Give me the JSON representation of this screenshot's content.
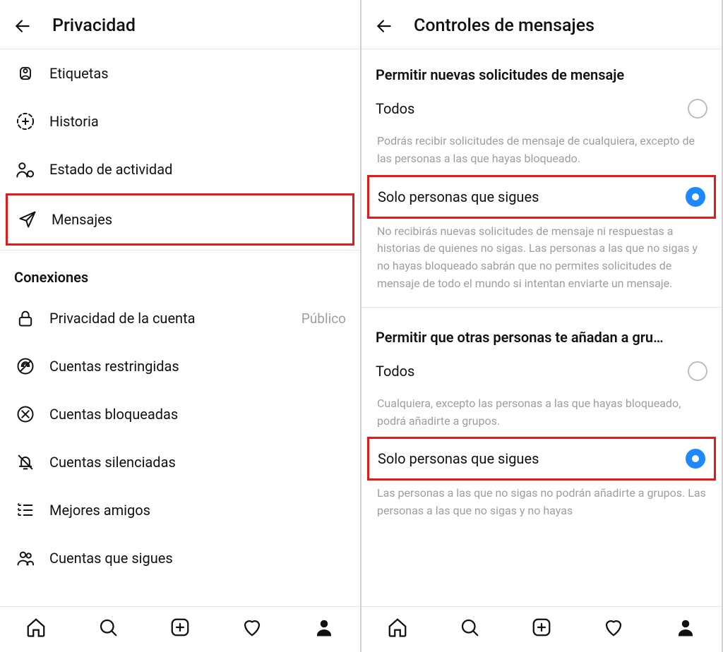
{
  "left": {
    "title": "Privacidad",
    "items_top": [
      {
        "icon": "tags-icon",
        "label": "Etiquetas"
      },
      {
        "icon": "story-icon",
        "label": "Historia"
      },
      {
        "icon": "activity-icon",
        "label": "Estado de actividad"
      }
    ],
    "highlighted_item": {
      "icon": "messages-icon",
      "label": "Mensajes"
    },
    "section_title": "Conexiones",
    "items_bottom": [
      {
        "icon": "lock-icon",
        "label": "Privacidad de la cuenta",
        "meta": "Público"
      },
      {
        "icon": "restricted-icon",
        "label": "Cuentas restringidas"
      },
      {
        "icon": "blocked-icon",
        "label": "Cuentas bloqueadas"
      },
      {
        "icon": "muted-icon",
        "label": "Cuentas silenciadas"
      },
      {
        "icon": "close-friends-icon",
        "label": "Mejores amigos"
      },
      {
        "icon": "following-icon",
        "label": "Cuentas que sigues"
      }
    ]
  },
  "right": {
    "title": "Controles de mensajes",
    "section1": {
      "head": "Permitir nuevas solicitudes de mensaje",
      "opt1_label": "Todos",
      "opt1_desc": "Podrás recibir solicitudes de mensaje de cualquiera, excepto de las personas a las que hayas bloqueado.",
      "opt2_label": "Solo personas que sigues",
      "opt2_desc": "No recibirás nuevas solicitudes de mensaje ni respuestas a historias de quienes no sigas. Las personas a las que no sigas y no hayas bloqueado sabrán que no permites solicitudes de mensaje de todo el mundo si intentan enviarte un mensaje."
    },
    "section2": {
      "head": "Permitir que otras personas te añadan a gru…",
      "opt1_label": "Todos",
      "opt1_desc": "Cualquiera, excepto las personas a las que hayas bloqueado, podrá añadirte a grupos.",
      "opt2_label": "Solo personas que sigues",
      "opt2_desc": "Las personas a las que no sigas no podrán añadirte a grupos. Las personas a las que no sigas y no hayas"
    }
  }
}
